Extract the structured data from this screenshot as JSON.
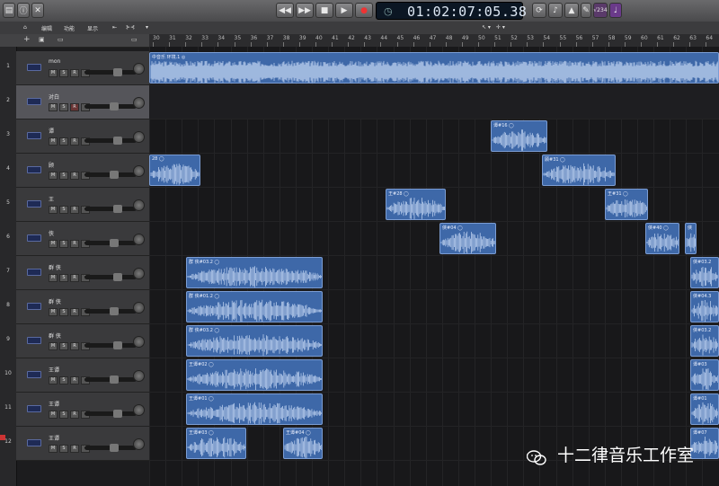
{
  "toolbar": {
    "left_icons": [
      "library-icon",
      "inspector-icon",
      "mixer-icon"
    ],
    "transport": [
      "rewind-icon",
      "fast-forward-icon",
      "stop-icon",
      "play-icon",
      "record-icon"
    ],
    "lcd_time": "01:02:07:05.38",
    "right_icons": [
      "cycle-icon",
      "tuner-icon",
      "metronome-icon",
      "count-in-icon"
    ],
    "right_badge": "√234"
  },
  "menubar": {
    "edit": "编辑",
    "functions": "功能",
    "view": "显示",
    "snap": "▾",
    "catch_icon": "catch-icon"
  },
  "ruler": {
    "bars": [
      "30",
      "31",
      "32",
      "33",
      "34",
      "35",
      "36",
      "37",
      "38",
      "39",
      "40",
      "41",
      "42",
      "43",
      "44",
      "45",
      "46",
      "47",
      "48",
      "49",
      "50",
      "51",
      "52",
      "53",
      "54",
      "55",
      "56",
      "57",
      "58",
      "59",
      "60",
      "61",
      "62",
      "63",
      "64"
    ]
  },
  "tracks": [
    {
      "num": "1",
      "name": "mon",
      "selected": false
    },
    {
      "num": "2",
      "name": "对白",
      "selected": true
    },
    {
      "num": "3",
      "name": "谭",
      "selected": false
    },
    {
      "num": "4",
      "name": "顾",
      "selected": false
    },
    {
      "num": "5",
      "name": "王",
      "selected": false
    },
    {
      "num": "6",
      "name": "侠",
      "selected": false
    },
    {
      "num": "7",
      "name": "群 侠",
      "selected": false
    },
    {
      "num": "8",
      "name": "群 侠",
      "selected": false
    },
    {
      "num": "9",
      "name": "群 侠",
      "selected": false
    },
    {
      "num": "10",
      "name": "王谭",
      "selected": false
    },
    {
      "num": "11",
      "name": "王谭",
      "selected": false
    },
    {
      "num": "12",
      "name": "王谭",
      "selected": false
    }
  ],
  "msri": [
    "M",
    "S",
    "R",
    "I"
  ],
  "regions": [
    {
      "track": 0,
      "label": "中音乐 环境.1 ◎",
      "start": 0,
      "end": 1,
      "dense": true
    },
    {
      "track": 2,
      "label": "谭#16 ◯",
      "start": 0.6,
      "end": 0.7
    },
    {
      "track": 3,
      "label": "28 ◯",
      "start": 0,
      "end": 0.09
    },
    {
      "track": 3,
      "label": "顾#31 ◯",
      "start": 0.69,
      "end": 0.82
    },
    {
      "track": 4,
      "label": "王#28 ◯",
      "start": 0.415,
      "end": 0.52
    },
    {
      "track": 4,
      "label": "王#31 ◯",
      "start": 0.8,
      "end": 0.875
    },
    {
      "track": 5,
      "label": "侠#04 ◯",
      "start": 0.51,
      "end": 0.61
    },
    {
      "track": 5,
      "label": "侠#40 ◯",
      "start": 0.87,
      "end": 0.93
    },
    {
      "track": 5,
      "label": "侠",
      "start": 0.94,
      "end": 0.96
    },
    {
      "track": 6,
      "label": "群 侠#03.2 ◯",
      "start": 0.065,
      "end": 0.305
    },
    {
      "track": 6,
      "label": "侠#03.2",
      "start": 0.95,
      "end": 1
    },
    {
      "track": 7,
      "label": "群 侠#01.2 ◯",
      "start": 0.065,
      "end": 0.305
    },
    {
      "track": 7,
      "label": "侠#04.3",
      "start": 0.95,
      "end": 1
    },
    {
      "track": 8,
      "label": "群 侠#03.2 ◯",
      "start": 0.065,
      "end": 0.305
    },
    {
      "track": 8,
      "label": "侠#03.2",
      "start": 0.95,
      "end": 1
    },
    {
      "track": 9,
      "label": "王谭#02 ◯",
      "start": 0.065,
      "end": 0.305
    },
    {
      "track": 9,
      "label": "谭#03",
      "start": 0.95,
      "end": 1
    },
    {
      "track": 10,
      "label": "王谭#01 ◯",
      "start": 0.065,
      "end": 0.305
    },
    {
      "track": 10,
      "label": "谭#01",
      "start": 0.95,
      "end": 1
    },
    {
      "track": 11,
      "label": "王谭#03 ◯",
      "start": 0.065,
      "end": 0.17
    },
    {
      "track": 11,
      "label": "王谭#04 ◯",
      "start": 0.235,
      "end": 0.305
    },
    {
      "track": 11,
      "label": "谭#07",
      "start": 0.95,
      "end": 1
    }
  ],
  "watermark": "十二律音乐工作室",
  "colors": {
    "region": "#3e68a8",
    "region_border": "#7b9dd4",
    "waveform": "#c8daf6",
    "lcd_text": "#dfe9f5"
  }
}
